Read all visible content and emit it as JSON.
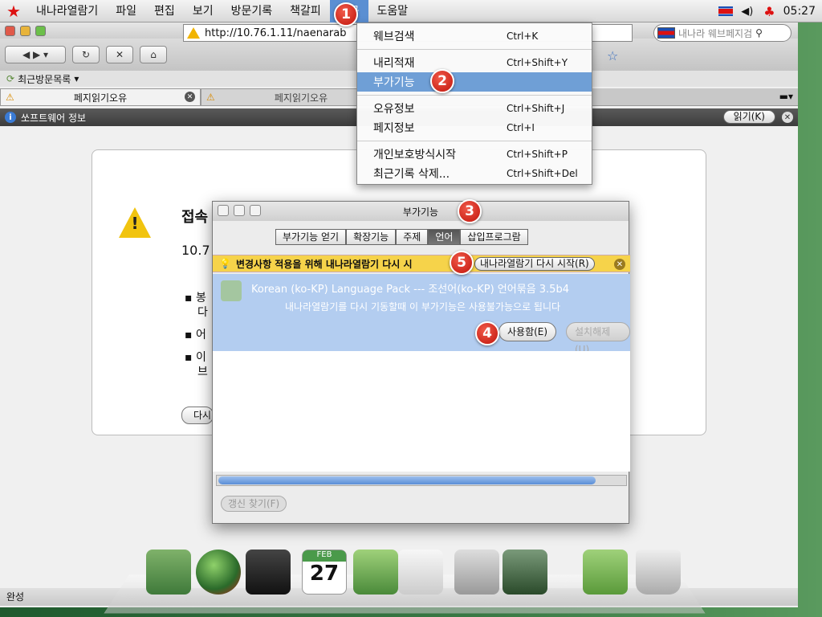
{
  "menubar": {
    "items": [
      "내나라열람기",
      "파일",
      "편집",
      "보기",
      "방문기록",
      "책갈피",
      "도구",
      "도움말"
    ],
    "time": "05:27"
  },
  "toolbar": {
    "url": "http://10.76.1.11/naenarab",
    "search_placeholder": "내나라 웨브페지검"
  },
  "bookmarks": {
    "label": "최근방문목록"
  },
  "tabs": [
    {
      "label": "페지읽기오유"
    },
    {
      "label": "페지읽기오유"
    }
  ],
  "infobar": {
    "text": "쏘프트웨어 정보",
    "read_button": "읽기(K)"
  },
  "error_page": {
    "title": "접속",
    "url_fragment": "10.7",
    "bullets": [
      "봉",
      "다",
      "어",
      "이",
      "브"
    ],
    "retry_button": "다시"
  },
  "tools_menu": {
    "items": [
      {
        "label": "웨브검색",
        "shortcut": "Ctrl+K"
      },
      {
        "label": "내리적재",
        "shortcut": "Ctrl+Shift+Y"
      },
      {
        "label": "부가기능",
        "shortcut": ""
      },
      {
        "label": "오유정보",
        "shortcut": "Ctrl+Shift+J"
      },
      {
        "label": "페지정보",
        "shortcut": "Ctrl+I"
      },
      {
        "label": "개인보호방식시작",
        "shortcut": "Ctrl+Shift+P"
      },
      {
        "label": "최근기록 삭제...",
        "shortcut": "Ctrl+Shift+Del"
      }
    ]
  },
  "addons_dialog": {
    "title": "부가기능",
    "tabs": [
      "부가기능 얻기",
      "확장기능",
      "주제",
      "언어",
      "삽입프로그람"
    ],
    "selected_tab": "언어",
    "notice": "변경사항 적용을 위해 내나라열람기 다시 시",
    "restart_button": "내나라열람기 다시 시작(R)",
    "addon_name": "Korean (ko-KP) Language Pack --- 조선어(ko-KP) 언어묶음  3.5b4",
    "addon_desc": "내나라열람기를 다시 기동할때 이 부가기능은 사용불가능으로 됩니다",
    "enable_button": "사용함(E)",
    "uninstall_button": "설치해제(U)",
    "update_button": "갱신 찾기(F)"
  },
  "statusbar": {
    "text": "완성"
  },
  "annotations": [
    "1",
    "2",
    "3",
    "4",
    "5"
  ]
}
